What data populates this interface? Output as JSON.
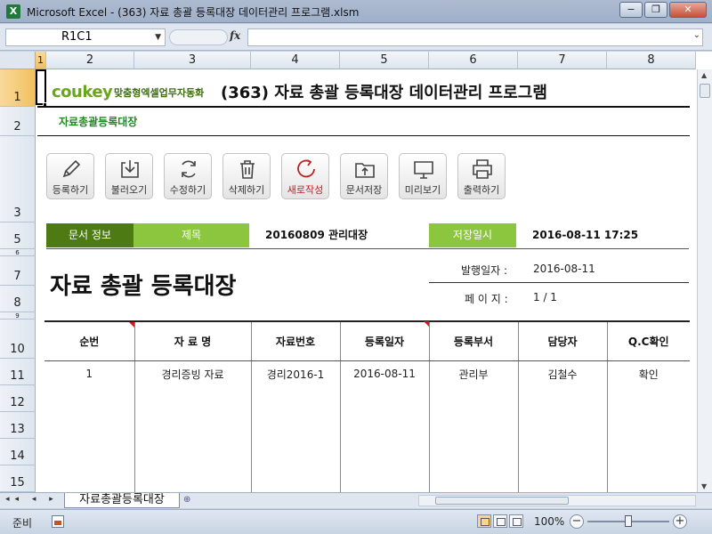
{
  "window": {
    "title": "Microsoft Excel - (363) 자료 총괄 등록대장 데이터관리 프로그램.xlsm",
    "minimize": "−",
    "restore": "❐",
    "close": "✕"
  },
  "formula_bar": {
    "name_box": "R1C1",
    "fx": "fx",
    "formula": ""
  },
  "columns": [
    "1",
    "2",
    "3",
    "4",
    "5",
    "6",
    "7",
    "8"
  ],
  "rows": [
    "1",
    "2",
    "3",
    "5",
    "6",
    "7",
    "8",
    "9",
    "10",
    "11",
    "12",
    "13",
    "14",
    "15"
  ],
  "sheet": {
    "logo": "coukey",
    "logo_sub": "맞춤형엑셀업무자동화",
    "main_title": "(363) 자료 총괄 등록대장 데이터관리 프로그램",
    "subtitle": "자료총괄등록대장",
    "toolbar": [
      {
        "label": "등록하기",
        "icon": "pencil-icon"
      },
      {
        "label": "불러오기",
        "icon": "download-icon"
      },
      {
        "label": "수정하기",
        "icon": "refresh-icon"
      },
      {
        "label": "삭제하기",
        "icon": "trash-icon"
      },
      {
        "label": "새로작성",
        "icon": "new-icon"
      },
      {
        "label": "문서저장",
        "icon": "folder-upload-icon"
      },
      {
        "label": "미리보기",
        "icon": "monitor-icon"
      },
      {
        "label": "출력하기",
        "icon": "printer-icon"
      }
    ],
    "info": {
      "doc_info_label": "문서 정보",
      "title_label": "제목",
      "title_value": "20160809 관리대장",
      "saved_label": "저장일시",
      "saved_value": "2016-08-11 17:25"
    },
    "doc_title": "자료 총괄 등록대장",
    "issue_date_label": "발행일자 :",
    "issue_date": "2016-08-11",
    "page_label": "페 이 지 :",
    "page_value": "1 / 1",
    "table": {
      "headers": [
        "순번",
        "자 료 명",
        "자료번호",
        "등록일자",
        "등록부서",
        "담당자",
        "Q.C확인"
      ],
      "rows": [
        [
          "1",
          "경리증빙 자료",
          "경리2016-1",
          "2016-08-11",
          "관리부",
          "김철수",
          "확인"
        ],
        [
          "",
          "",
          "",
          "",
          "",
          "",
          ""
        ],
        [
          "",
          "",
          "",
          "",
          "",
          "",
          ""
        ],
        [
          "",
          "",
          "",
          "",
          "",
          "",
          ""
        ],
        [
          "",
          "",
          "",
          "",
          "",
          "",
          ""
        ]
      ]
    }
  },
  "tabs": {
    "active": "자료총괄등록대장",
    "nav": "◂◂ ◂ ▸ ▸▸"
  },
  "status": {
    "ready": "준비",
    "zoom": "100%",
    "zoom_minus": "−",
    "zoom_plus": "+"
  },
  "colors": {
    "accent_dark_green": "#4d7a12",
    "accent_green": "#8cc63f",
    "subtitle_green": "#1f8a1f",
    "new_red": "#c02020"
  }
}
